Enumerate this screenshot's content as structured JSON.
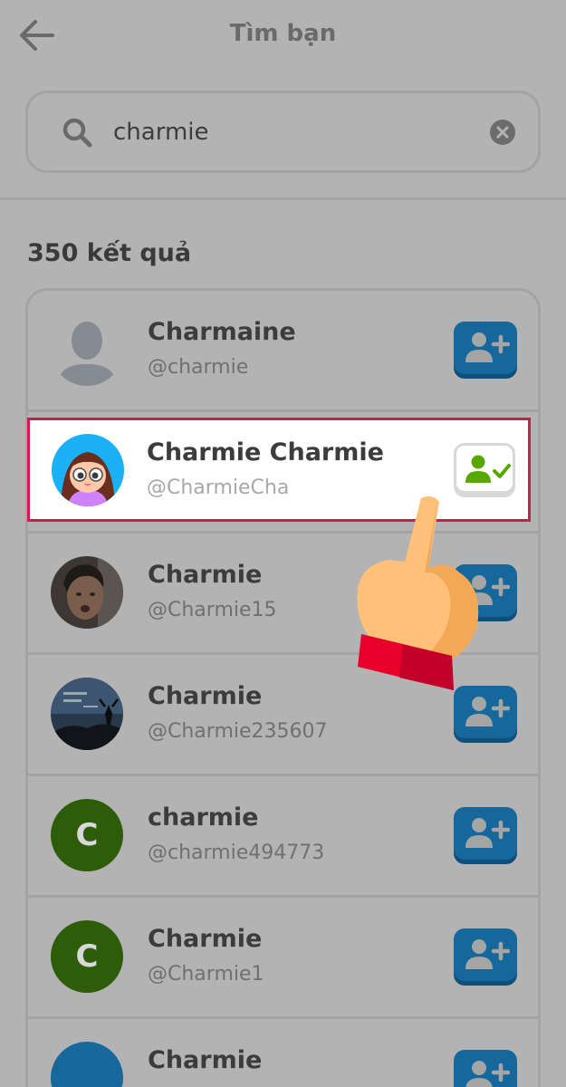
{
  "header": {
    "title": "Tìm bạn",
    "back_icon": "arrow-left-icon"
  },
  "search": {
    "value": "charmie",
    "placeholder": "",
    "search_icon": "search-icon",
    "clear_icon": "clear-icon"
  },
  "results": {
    "count_label": "350 kết quả"
  },
  "users": [
    {
      "name": "Charmaine",
      "handle": "@charmie",
      "avatar": "default-silhouette",
      "action": "add-friend"
    },
    {
      "name": "Charmie Charmie",
      "handle": "@CharmieCha",
      "avatar": "cartoon-girl",
      "action": "friend-added"
    },
    {
      "name": "Charmie",
      "handle": "@Charmie15",
      "avatar": "photo-face",
      "action": "add-friend"
    },
    {
      "name": "Charmie",
      "handle": "@Charmie235607",
      "avatar": "photo-landscape",
      "action": "add-friend"
    },
    {
      "name": "charmie",
      "handle": "@charmie494773",
      "avatar": "letter",
      "letter": "C",
      "action": "add-friend"
    },
    {
      "name": "Charmie",
      "handle": "@Charmie1",
      "avatar": "letter",
      "letter": "C",
      "action": "add-friend"
    },
    {
      "name": "Charmie",
      "handle": "",
      "avatar": "blue-circle",
      "action": "add-friend"
    }
  ],
  "colors": {
    "overlay_bg": "#b3b3b3",
    "add_button": "#16679c",
    "highlight_border": "#d21a4a",
    "letter_avatar": "#2e5d0a",
    "check_green": "#58a700"
  }
}
